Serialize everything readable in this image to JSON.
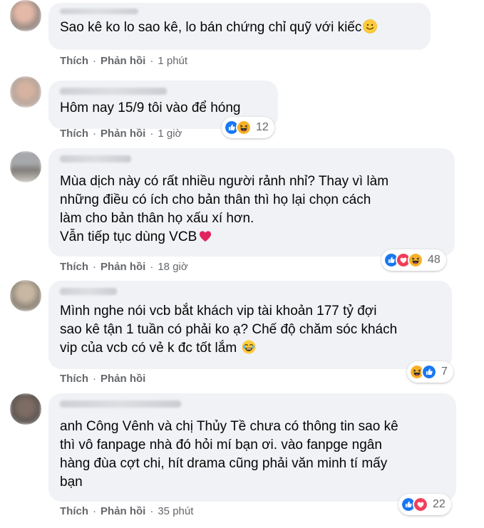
{
  "comments": [
    {
      "text": "Sao kê ko lo sao kê, lo bán chứng chỉ quỹ với kiếc",
      "trailing_emoji": "smile",
      "like_label": "Thích",
      "reply_label": "Phản hồi",
      "time": "1 phút"
    },
    {
      "text": "Hôm nay 15/9 tôi vào để hóng",
      "like_label": "Thích",
      "reply_label": "Phản hồi",
      "time": "1 giờ",
      "reactions": [
        "like",
        "haha"
      ],
      "reaction_count": "12"
    },
    {
      "text": "Mùa dịch này có rất nhiều người rảnh nhỉ? Thay vì làm\nnhững điều có ích cho bản thân thì họ lại chọn cách\nlàm cho bản thân họ xấu xí hơn.\nVẫn tiếp tục dùng VCB",
      "trailing_emoji": "heart",
      "like_label": "Thích",
      "reply_label": "Phản hồi",
      "time": "18 giờ",
      "reactions": [
        "like",
        "love",
        "haha"
      ],
      "reaction_count": "48"
    },
    {
      "text": "Mình nghe nói vcb bắt khách vip tài khoản 177 tỷ đợi\nsao kê tận 1 tuần có phải ko ạ? Chế độ chăm sóc khách\nvip của vcb có vẻ k đc tốt lắm",
      "trailing_emoji": "joy",
      "like_label": "Thích",
      "reply_label": "Phản hồi",
      "time": "",
      "reactions": [
        "haha",
        "like"
      ],
      "reaction_count": "7"
    },
    {
      "text": "anh Công Vênh và chị Thủy Tề chưa có thông tin sao kê\nthì vô fanpage nhà đó hỏi mí bạn ơi. vào fanpge ngân\nhàng đùa cợt chi, hít drama cũng phải văn minh tí mấy\nbạn",
      "like_label": "Thích",
      "reply_label": "Phản hồi",
      "time": "35 phút",
      "reactions": [
        "like",
        "love"
      ],
      "reaction_count": "22"
    }
  ],
  "colors": {
    "bubble": "#f0f2f5",
    "meta": "#65676b",
    "like": "#1877f2",
    "love": "#f33e58",
    "haha": "#f7b125"
  }
}
